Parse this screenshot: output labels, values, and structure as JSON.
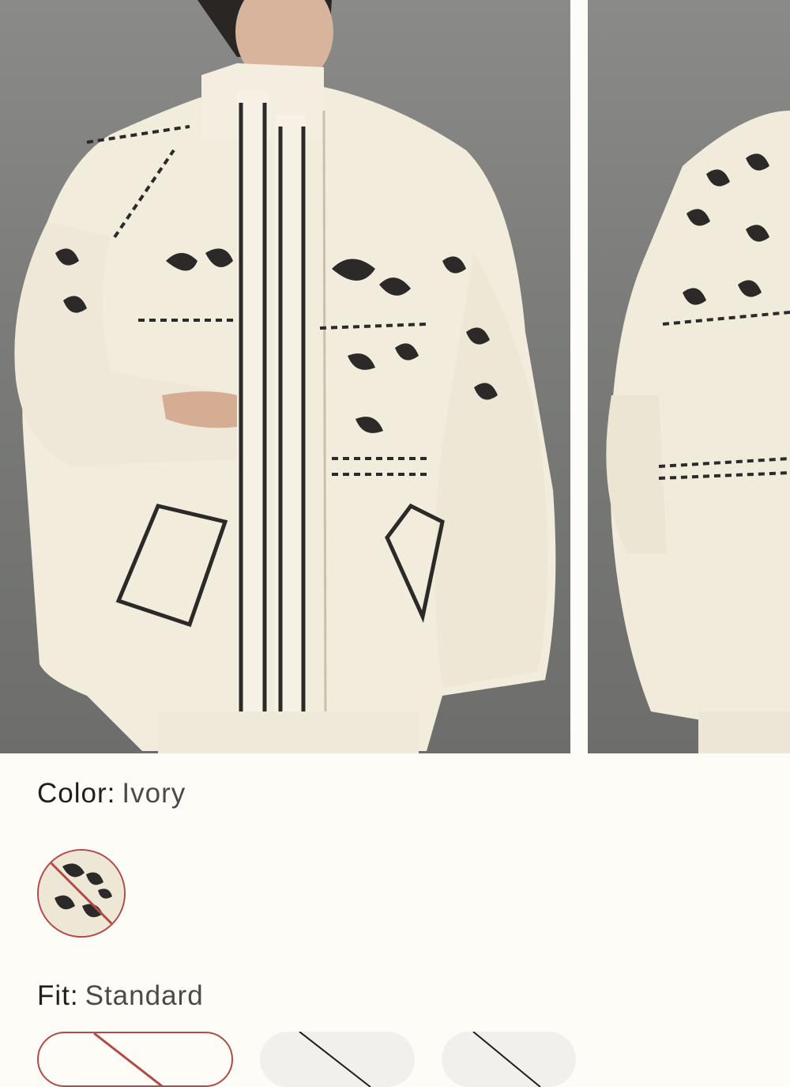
{
  "gallery": {
    "images": [
      {
        "alt": "Model wearing ivory embroidered puffer jacket, front view"
      },
      {
        "alt": "Ivory embroidered puffer jacket, side view"
      }
    ]
  },
  "color": {
    "label": "Color:",
    "value": "Ivory",
    "swatches": [
      {
        "name": "Ivory",
        "state": "unavailable",
        "selected": true
      }
    ]
  },
  "fit": {
    "label": "Fit:",
    "value": "Standard",
    "options": [
      {
        "label": "",
        "selected": true,
        "state": "unavailable"
      },
      {
        "label": "",
        "selected": false,
        "state": "unavailable"
      },
      {
        "label": "",
        "selected": false,
        "state": "unavailable"
      }
    ]
  },
  "colors": {
    "accent": "#b24a48",
    "photo_background": "#7c7d7b",
    "jacket": "#f2ecdd",
    "embroidery": "#2b2a28"
  }
}
